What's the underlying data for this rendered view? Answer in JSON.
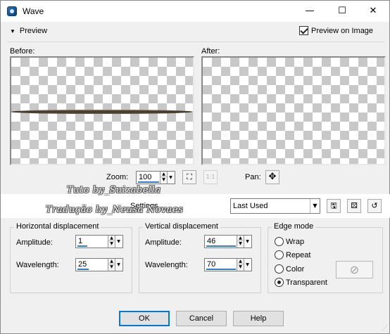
{
  "window": {
    "title": "Wave",
    "minimize_glyph": "—",
    "maximize_glyph": "☐",
    "close_glyph": "✕"
  },
  "preview": {
    "toggle_label": "Preview",
    "preview_on_image_label": "Preview on Image",
    "preview_on_image_checked": true,
    "before_label": "Before:",
    "after_label": "After:"
  },
  "zoom": {
    "label": "Zoom:",
    "value": "100",
    "pan_label": "Pan:"
  },
  "settings": {
    "label": "Settings",
    "preset_value": "Last Used"
  },
  "watermark": {
    "line1": "Tuto by_Suizabella",
    "line2": "Tradução by_Neusa Novaes"
  },
  "horizontal": {
    "title": "Horizontal displacement",
    "amplitude_label": "Amplitude:",
    "amplitude_value": "1",
    "wavelength_label": "Wavelength:",
    "wavelength_value": "25"
  },
  "vertical": {
    "title": "Vertical displacement",
    "amplitude_label": "Amplitude:",
    "amplitude_value": "46",
    "wavelength_label": "Wavelength:",
    "wavelength_value": "70"
  },
  "edge_mode": {
    "title": "Edge mode",
    "options": [
      "Wrap",
      "Repeat",
      "Color",
      "Transparent"
    ],
    "selected": "Transparent"
  },
  "buttons": {
    "ok": "OK",
    "cancel": "Cancel",
    "help": "Help"
  },
  "icons": {
    "app": "wave-app-icon",
    "zoom_fit": "zoom-fit-icon",
    "zoom_1to1": "zoom-actual-size-icon",
    "pan": "pan-crosshair-icon",
    "save_preset": "save-preset-icon",
    "randomize": "randomize-dice-icon",
    "reset": "reset-icon",
    "color_none": "no-color-icon"
  },
  "colors": {
    "accent": "#0078d7",
    "focus_underline": "#2f7bd4"
  }
}
